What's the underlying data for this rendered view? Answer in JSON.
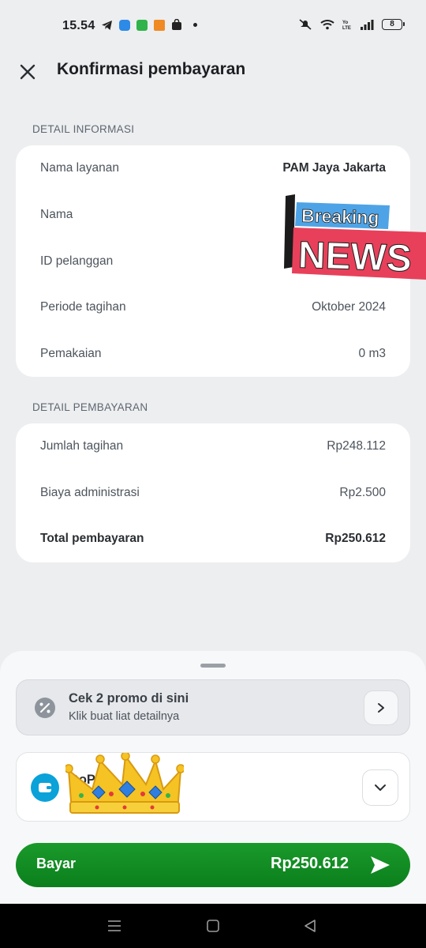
{
  "status_bar": {
    "time": "15.54",
    "battery": "8"
  },
  "header": {
    "title": "Konfirmasi pembayaran"
  },
  "detail_informasi": {
    "section_label": "DETAIL INFORMASI",
    "rows": [
      {
        "label": "Nama layanan",
        "value": "PAM Jaya Jakarta"
      },
      {
        "label": "Nama",
        "value": ""
      },
      {
        "label": "ID pelanggan",
        "value": ""
      },
      {
        "label": "Periode tagihan",
        "value": "Oktober 2024"
      },
      {
        "label": "Pemakaian",
        "value": "0 m3"
      }
    ]
  },
  "sticker": {
    "line1": "Breaking",
    "line2": "NEWS"
  },
  "detail_pembayaran": {
    "section_label": "DETAIL PEMBAYARAN",
    "rows": [
      {
        "label": "Jumlah tagihan",
        "value": "Rp248.112"
      },
      {
        "label": "Biaya administrasi",
        "value": "Rp2.500"
      },
      {
        "label": "Total pembayaran",
        "value": "Rp250.612"
      }
    ]
  },
  "promo": {
    "title": "Cek 2 promo di sini",
    "subtitle": "Klik buat liat detailnya"
  },
  "payment_method": {
    "label": "GoPay"
  },
  "pay_button": {
    "label": "Bayar",
    "amount": "Rp250.612"
  },
  "colors": {
    "primary_green": "#0b7f1c",
    "wallet_blue": "#0aa2d8",
    "sticker_red": "#e8405a",
    "sticker_blue": "#4ea3e6"
  }
}
